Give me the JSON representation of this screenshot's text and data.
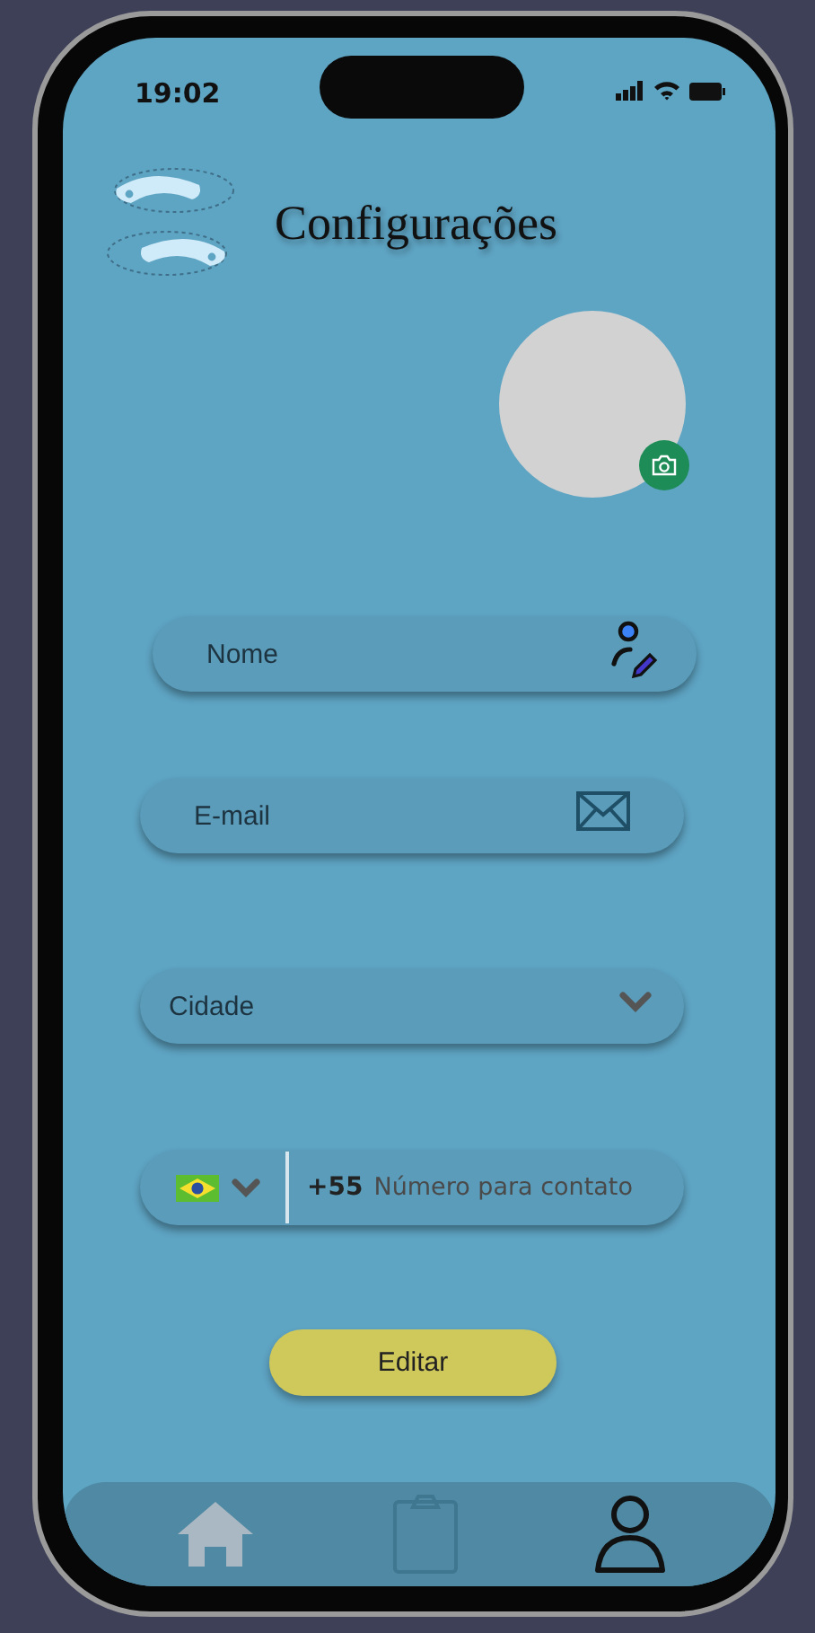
{
  "status_bar": {
    "time": "19:02"
  },
  "header": {
    "title": "Configurações"
  },
  "fields": [
    {
      "kind": "name",
      "placeholder": "Nome"
    },
    {
      "kind": "email",
      "placeholder": "E-mail"
    },
    {
      "kind": "select",
      "placeholder": "Cidade"
    },
    {
      "kind": "phone",
      "country_code": "+55",
      "placeholder": "Número para contato"
    }
  ],
  "button": {
    "label": "Editar"
  },
  "nav": [
    {
      "kind": "home",
      "selected": false
    },
    {
      "kind": "clipboard",
      "selected": false
    },
    {
      "kind": "profile",
      "selected": true
    }
  ]
}
